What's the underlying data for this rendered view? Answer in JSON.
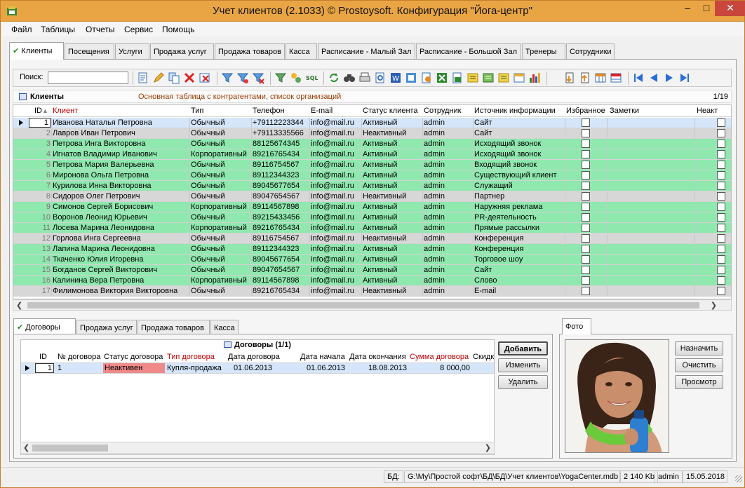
{
  "window": {
    "title": "Учет клиентов (2.1033) © Prostoysoft. Конфигурация \"Йога-центр\"",
    "minimize": "–",
    "maximize": "□",
    "close": "✕"
  },
  "menu": [
    "Файл",
    "Таблицы",
    "Отчеты",
    "Сервис",
    "Помощь"
  ],
  "main_tabs": [
    "Клиенты",
    "Посещения",
    "Услуги",
    "Продажа услуг",
    "Продажа товаров",
    "Касса",
    "Расписание - Малый Зал",
    "Расписание - Большой Зал",
    "Тренеры",
    "Сотрудники"
  ],
  "active_tab_check": "✔",
  "toolbar": {
    "search_label": "Поиск:",
    "search_value": "",
    "sql_label": "SQL"
  },
  "clients": {
    "title": "Клиенты",
    "description": "Основная таблица с контрагентами, список организаций",
    "count": "1/19",
    "sort_marker": "▲",
    "columns": {
      "id": "ID",
      "client": "Клиент",
      "type": "Тип",
      "phone": "Телефон",
      "email": "E-mail",
      "status": "Статус клиента",
      "employee": "Сотрудник",
      "source": "Источник информации",
      "favorite": "Избранное",
      "notes": "Заметки",
      "extra": "Неакт"
    },
    "rows": [
      {
        "id": "1",
        "name": "Иванова Наталья Петровна",
        "type": "Обычный",
        "phone": "+79112223344",
        "email": "info@mail.ru",
        "status": "Активный",
        "emp": "admin",
        "source": "Сайт",
        "style": "sel"
      },
      {
        "id": "2",
        "name": "Лавров Иван Петрович",
        "type": "Обычный",
        "phone": "+79113335566",
        "email": "info@mail.ru",
        "status": "Неактивный",
        "emp": "admin",
        "source": "Сайт",
        "style": "gray"
      },
      {
        "id": "3",
        "name": "Петрова Инга Викторовна",
        "type": "Обычный",
        "phone": "88125674345",
        "email": "info@mail.ru",
        "status": "Активный",
        "emp": "admin",
        "source": "Исходящий звонок",
        "style": "green"
      },
      {
        "id": "4",
        "name": "Игнатов Владимир Иванович",
        "type": "Корпоративный",
        "phone": "89216765434",
        "email": "info@mail.ru",
        "status": "Активный",
        "emp": "admin",
        "source": "Исходящий звонок",
        "style": "green"
      },
      {
        "id": "5",
        "name": "Петрова Мария Валерьевна",
        "type": "Обычный",
        "phone": "89116754567",
        "email": "info@mail.ru",
        "status": "Активный",
        "emp": "admin",
        "source": "Входящий звонок",
        "style": "green"
      },
      {
        "id": "6",
        "name": "Миронова Ольга Петровна",
        "type": "Обычный",
        "phone": "89112344323",
        "email": "info@mail.ru",
        "status": "Активный",
        "emp": "admin",
        "source": "Существующий клиент",
        "style": "green"
      },
      {
        "id": "7",
        "name": "Курилова Инна Викторовна",
        "type": "Обычный",
        "phone": "89045677654",
        "email": "info@mail.ru",
        "status": "Активный",
        "emp": "admin",
        "source": "Служащий",
        "style": "green"
      },
      {
        "id": "8",
        "name": "Сидоров Олег Петрович",
        "type": "Обычный",
        "phone": "89047654567",
        "email": "info@mail.ru",
        "status": "Неактивный",
        "emp": "admin",
        "source": "Партнер",
        "style": "gray"
      },
      {
        "id": "9",
        "name": "Симонов Сергей Борисович",
        "type": "Корпоративный",
        "phone": "89114567898",
        "email": "info@mail.ru",
        "status": "Активный",
        "emp": "admin",
        "source": "Наружняя реклама",
        "style": "green"
      },
      {
        "id": "10",
        "name": "Воронов Леонид Юрьевич",
        "type": "Обычный",
        "phone": "89215433456",
        "email": "info@mail.ru",
        "status": "Активный",
        "emp": "admin",
        "source": "PR-деятельность",
        "style": "green"
      },
      {
        "id": "11",
        "name": "Лосева Марина Леонидовна",
        "type": "Корпоративный",
        "phone": "89216765434",
        "email": "info@mail.ru",
        "status": "Активный",
        "emp": "admin",
        "source": "Прямые рассылки",
        "style": "green"
      },
      {
        "id": "12",
        "name": "Горлова Инга Сергеевна",
        "type": "Обычный",
        "phone": "89116754567",
        "email": "info@mail.ru",
        "status": "Неактивный",
        "emp": "admin",
        "source": "Конференция",
        "style": "gray"
      },
      {
        "id": "13",
        "name": "Лапина Марина Леонидовна",
        "type": "Обычный",
        "phone": "89112344323",
        "email": "info@mail.ru",
        "status": "Активный",
        "emp": "admin",
        "source": "Конференция",
        "style": "green"
      },
      {
        "id": "14",
        "name": "Ткаченко Юлия Игоревна",
        "type": "Обычный",
        "phone": "89045677654",
        "email": "info@mail.ru",
        "status": "Активный",
        "emp": "admin",
        "source": "Торговое шоу",
        "style": "green"
      },
      {
        "id": "15",
        "name": "Богданов Сергей Викторович",
        "type": "Обычный",
        "phone": "89047654567",
        "email": "info@mail.ru",
        "status": "Активный",
        "emp": "admin",
        "source": "Сайт",
        "style": "green"
      },
      {
        "id": "16",
        "name": "Калинина Вера Петровна",
        "type": "Корпоративный",
        "phone": "89114567898",
        "email": "info@mail.ru",
        "status": "Активный",
        "emp": "admin",
        "source": "Слово",
        "style": "green"
      },
      {
        "id": "17",
        "name": "Филимонова Виктория Викторовна",
        "type": "Обычный",
        "phone": "89216765434",
        "email": "info@mail.ru",
        "status": "Неактивный",
        "emp": "admin",
        "source": "E-mail",
        "style": "gray"
      }
    ]
  },
  "sub_tabs": [
    "Договоры",
    "Продажа услуг",
    "Продажа товаров",
    "Касса"
  ],
  "contracts": {
    "title": "Договоры (1/1)",
    "columns": {
      "id": "ID",
      "num": "№ договора",
      "status": "Статус договора",
      "type": "Тип договора",
      "date": "Дата договора",
      "start": "Дата начала",
      "end": "Дата окончания",
      "sum": "Сумма договора",
      "disc": "Скидк"
    },
    "row": {
      "id": "1",
      "num": "1",
      "status": "Неактивен",
      "type": "Купля-продажа",
      "date": "01.06.2013",
      "start": "01.06.2013",
      "end": "18.08.2013",
      "sum": "8 000,00"
    },
    "buttons": {
      "add": "Добавить",
      "edit": "Изменить",
      "delete": "Удалить"
    }
  },
  "photo": {
    "tab": "Фото",
    "assign": "Назначить",
    "clear": "Очистить",
    "view": "Просмотр"
  },
  "status": {
    "db_label": "БД:",
    "db_path": "G:\\My\\Простой софт\\БД\\БД\\Учет клиентов\\YogaCenter.mdb",
    "size": "2 140 Kb",
    "user": "admin",
    "date": "15.05.2018"
  },
  "arrows": {
    "left": "❮",
    "right": "❯",
    "right_tri": "▶"
  }
}
